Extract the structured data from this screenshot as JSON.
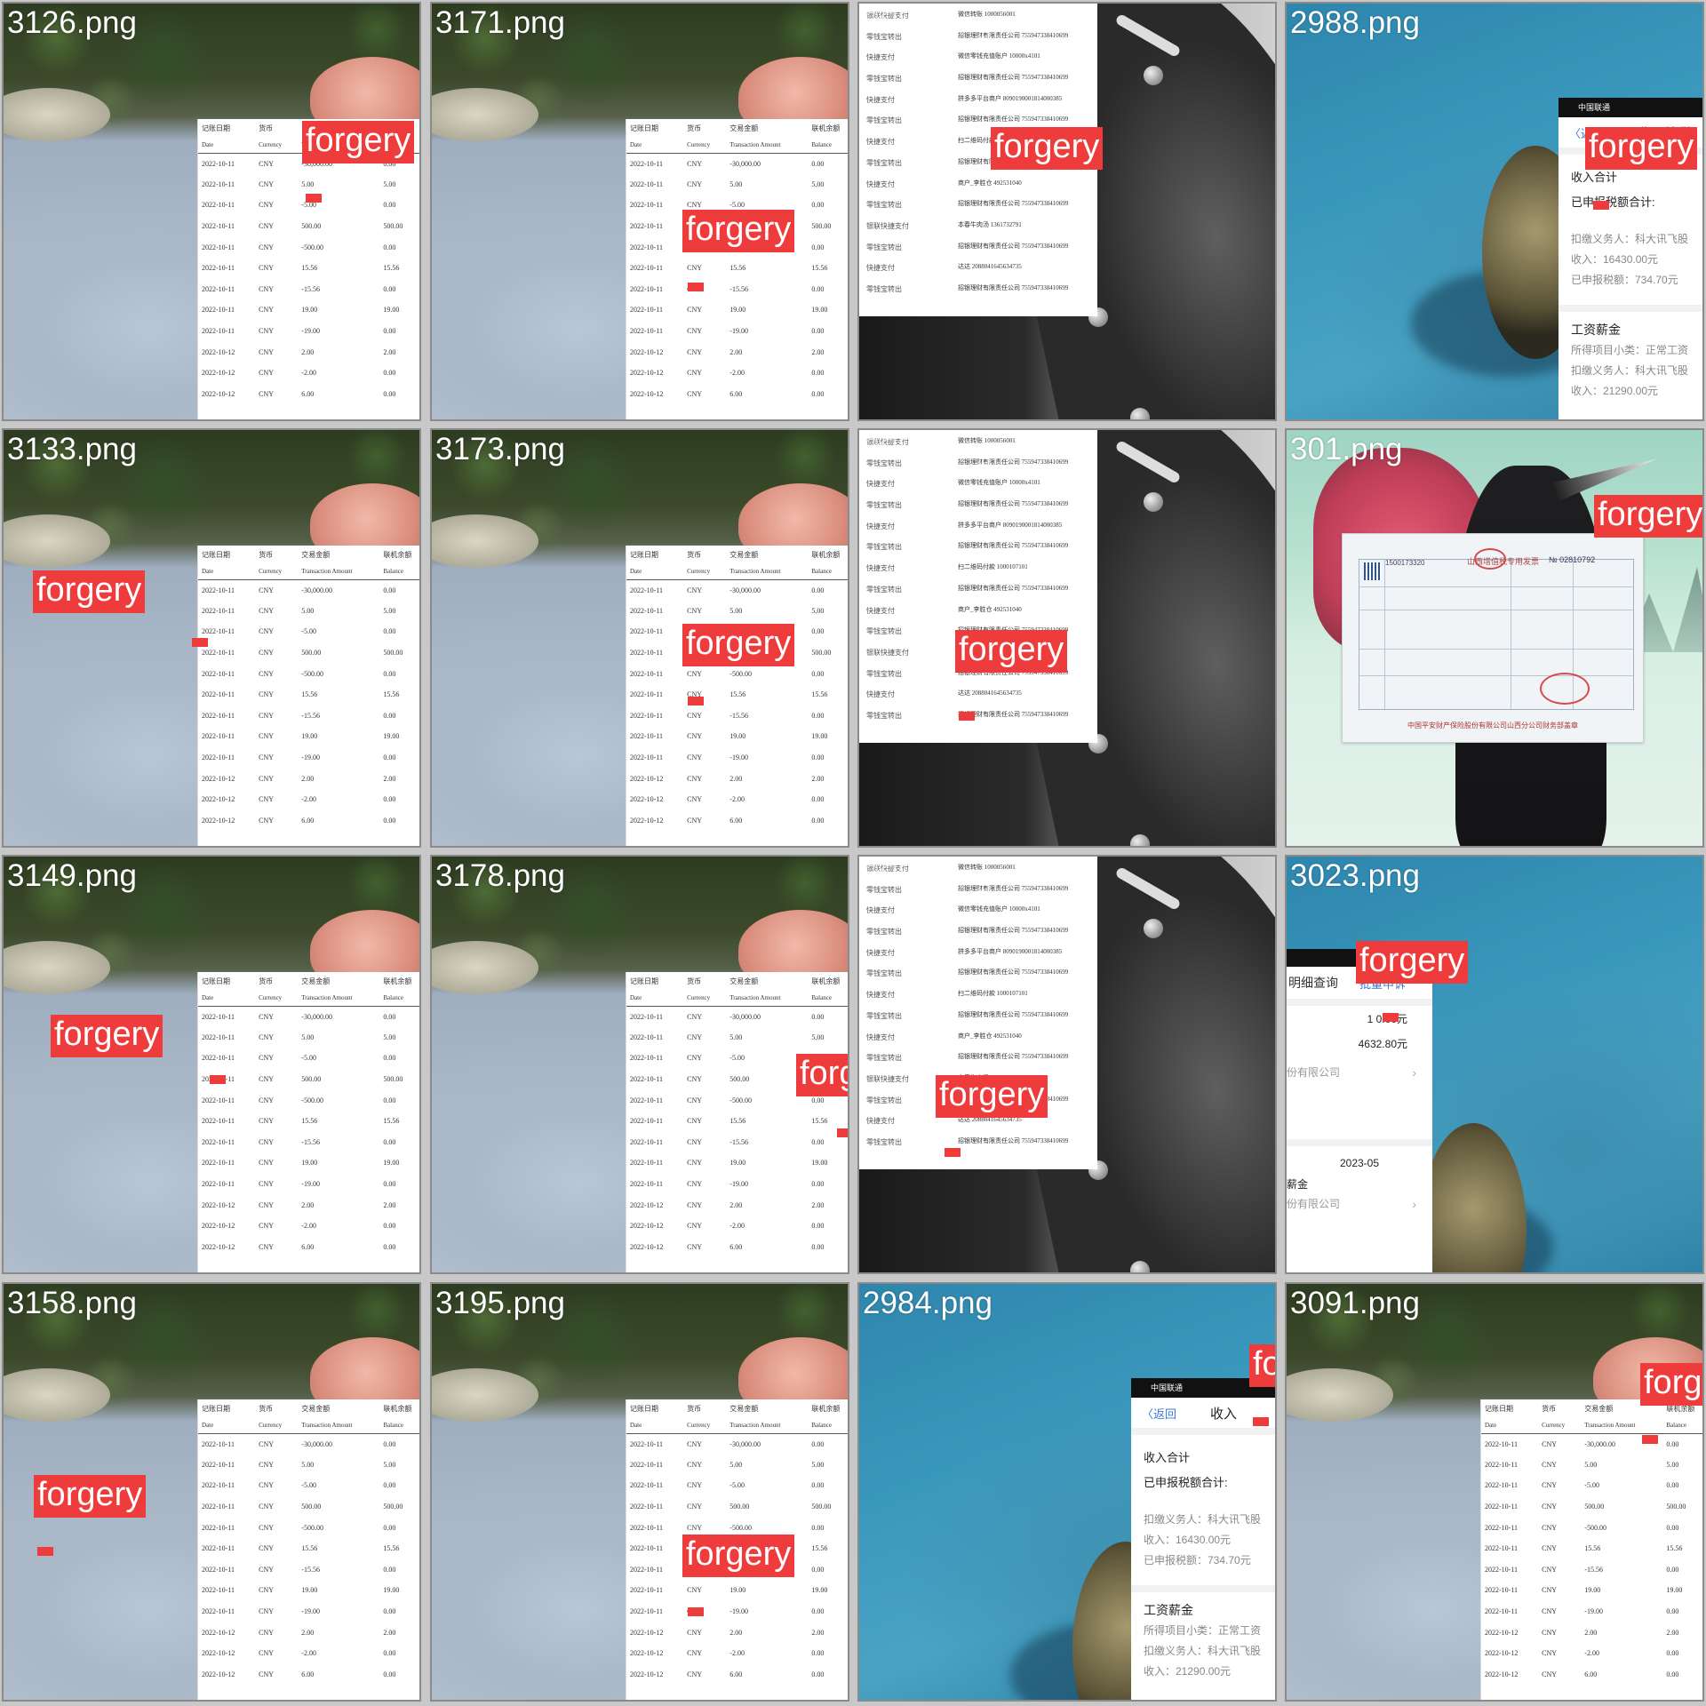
{
  "tiles": [
    {
      "file": "3126.png",
      "label": "forgery"
    },
    {
      "file": "3171.png",
      "label": "forgery"
    },
    {
      "file": "2982.png",
      "label": "forgery"
    },
    {
      "file": "2988.png",
      "label": "forgery"
    },
    {
      "file": "3133.png",
      "label": "forgery"
    },
    {
      "file": "3173.png",
      "label": "forgery"
    },
    {
      "file": "2983.png",
      "label": "forgery"
    },
    {
      "file": "301.png",
      "label": "forgery"
    },
    {
      "file": "3149.png",
      "label": "forgery"
    },
    {
      "file": "3178.png",
      "label": "forgery",
      "label2": "forgery"
    },
    {
      "file": "2985.png",
      "label": "forgery"
    },
    {
      "file": "3023.png",
      "label": "forgery"
    },
    {
      "file": "3158.png",
      "label": "forgery"
    },
    {
      "file": "3195.png",
      "label": "forgery"
    },
    {
      "file": "2984.png",
      "label": "forgery"
    },
    {
      "file": "3091.png",
      "label": "forg"
    }
  ],
  "statement": {
    "headers_cn": [
      "记账日期",
      "货币",
      "交易金额",
      "联机余额"
    ],
    "headers_en": [
      "Date",
      "Currency",
      "Transaction Amount",
      "Balance"
    ],
    "rows": [
      [
        "2022-10-11",
        "CNY",
        "-30,000.00",
        "0.00"
      ],
      [
        "2022-10-11",
        "CNY",
        "5.00",
        "5.00"
      ],
      [
        "2022-10-11",
        "CNY",
        "-5.00",
        "0.00"
      ],
      [
        "2022-10-11",
        "CNY",
        "500.00",
        "500.00"
      ],
      [
        "2022-10-11",
        "CNY",
        "-500.00",
        "0.00"
      ],
      [
        "2022-10-11",
        "CNY",
        "15.56",
        "15.56"
      ],
      [
        "2022-10-11",
        "CNY",
        "-15.56",
        "0.00"
      ],
      [
        "2022-10-11",
        "CNY",
        "19.00",
        "19.00"
      ],
      [
        "2022-10-11",
        "CNY",
        "-19.00",
        "0.00"
      ],
      [
        "2022-10-12",
        "CNY",
        "2.00",
        "2.00"
      ],
      [
        "2022-10-12",
        "CNY",
        "-2.00",
        "0.00"
      ],
      [
        "2022-10-12",
        "CNY",
        "6.00",
        "0.00"
      ]
    ]
  },
  "alipay_list": [
    [
      "银联快捷支付",
      "微信转账 1000056001"
    ],
    [
      "零钱宝转出",
      "招银理财有限责任公司 755947338410699"
    ],
    [
      "快捷支付",
      "微信零钱充值账户 10000x4101"
    ],
    [
      "零钱宝转出",
      "招银理财有限责任公司 755947338410699"
    ],
    [
      "快捷支付",
      "拼多多平台商户 8090190001814000385"
    ],
    [
      "零钱宝转出",
      "招银理财有限责任公司 755947338410699"
    ],
    [
      "快捷支付",
      "扫二维码付款 1000107101"
    ],
    [
      "零钱宝转出",
      "招银理财有限责任公司 755947338410699"
    ],
    [
      "快捷支付",
      "商户_李胜仓 492531040"
    ],
    [
      "零钱宝转出",
      "招银理财有限责任公司 755947338410699"
    ],
    [
      "银联快捷支付",
      "本春牛肉汤 1361732791"
    ],
    [
      "零钱宝转出",
      "招银理财有限责任公司 755947338410699"
    ],
    [
      "快捷支付",
      "达达 2088041645634735"
    ],
    [
      "零钱宝转出",
      "招银理财有限责任公司 755947338410699"
    ]
  ],
  "tax": {
    "carrier": "中国联通",
    "back": "〈返回",
    "title": "收入纳税",
    "title_cut": "收入",
    "income_total": "收入合计",
    "declared_total": "已申报税额合计:",
    "withholder": "扣缴义务人：科大讯飞股",
    "income": "收入：16430.00元",
    "declared": "已申报税额：734.70元",
    "salary": "工资薪金",
    "subtype": "所得项目小类：正常工资",
    "withholder2": "扣缴义务人：科大讯飞股",
    "income2": "收入：21290.00元"
  },
  "detail": {
    "status_time": "1:28",
    "title": "明细查询",
    "link": "批量申诉",
    "amount1": "1",
    "amount1_suffix": "0.00元",
    "amount2": "4632.80元",
    "company": "份有限公司",
    "month": "2023-05",
    "salary": "薪金",
    "company2": "份有限公司"
  },
  "invoice": {
    "num_left": "1500173320",
    "title": "山西增值税专用发票",
    "num_right": "№ 02810792",
    "footer": "中国平安财产保险股份有限公司山西分公司财务部盖章"
  }
}
